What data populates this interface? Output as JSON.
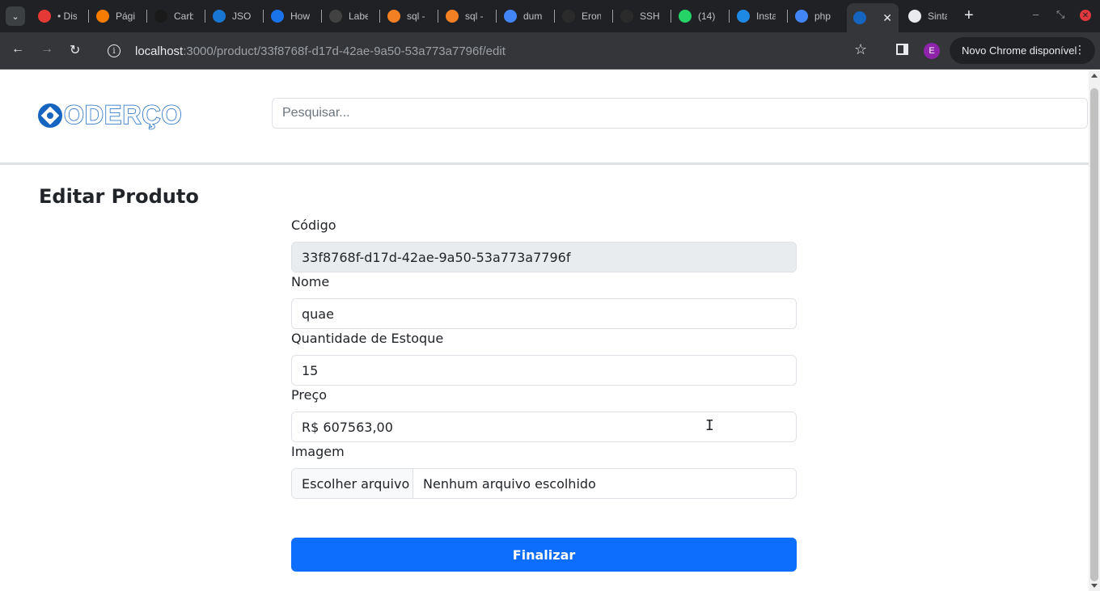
{
  "browser": {
    "tabs": [
      {
        "title": "• Dis",
        "favicon_color": "#e53935"
      },
      {
        "title": "Pági",
        "favicon_color": "#f57c00"
      },
      {
        "title": "Carb",
        "favicon_color": "#1a1a1a"
      },
      {
        "title": "JSON",
        "favicon_color": "#1976d2"
      },
      {
        "title": "How",
        "favicon_color": "#1a73e8"
      },
      {
        "title": "Labe",
        "favicon_color": "#424242"
      },
      {
        "title": "sql -",
        "favicon_color": "#f48024"
      },
      {
        "title": "sql -",
        "favicon_color": "#f48024"
      },
      {
        "title": "dum",
        "favicon_color": "#4285f4"
      },
      {
        "title": "Eron",
        "favicon_color": "#2b2b2b"
      },
      {
        "title": "SSH",
        "favicon_color": "#2b2b2b"
      },
      {
        "title": "(14) \\",
        "favicon_color": "#25d366"
      },
      {
        "title": "Insta",
        "favicon_color": "#1e88e5"
      },
      {
        "title": "php",
        "favicon_color": "#4285f4"
      },
      {
        "title": "",
        "favicon_color": "#1565c0",
        "active": true
      },
      {
        "title": "Sinta",
        "favicon_color": "#e8eaed"
      }
    ],
    "url_host": "localhost",
    "url_rest": ":3000/product/33f8768f-d17d-42ae-9a50-53a773a7796f/edit",
    "profile_initial": "E",
    "update_label": "Novo Chrome disponível"
  },
  "header": {
    "logo_text": "ODERÇO",
    "search_placeholder": "Pesquisar..."
  },
  "page": {
    "title": "Editar Produto"
  },
  "form": {
    "code_label": "Código",
    "code_value": "33f8768f-d17d-42ae-9a50-53a773a7796f",
    "name_label": "Nome",
    "name_value": "quae",
    "stock_label": "Quantidade de Estoque",
    "stock_value": "15",
    "price_label": "Preço",
    "price_value": "R$ 607563,00",
    "image_label": "Imagem",
    "file_button": "Escolher arquivo",
    "file_name": "Nenhum arquivo escolhido",
    "submit_label": "Finalizar"
  },
  "colors": {
    "primary": "#0d6efd",
    "brand": "#1565c0"
  }
}
